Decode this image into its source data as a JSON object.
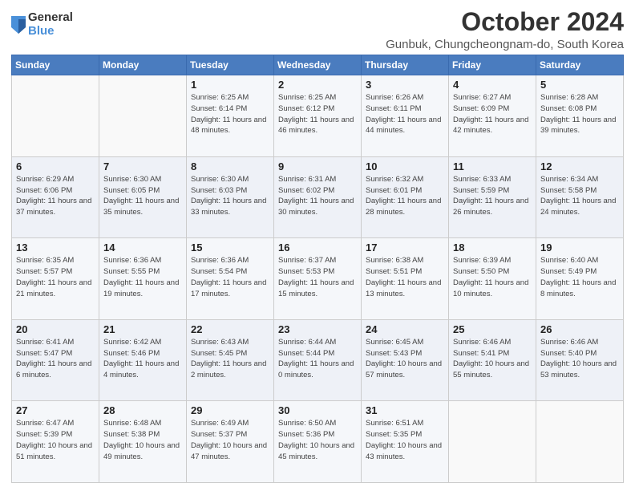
{
  "logo": {
    "general": "General",
    "blue": "Blue"
  },
  "header": {
    "title": "October 2024",
    "subtitle": "Gunbuk, Chungcheongnam-do, South Korea"
  },
  "columns": [
    "Sunday",
    "Monday",
    "Tuesday",
    "Wednesday",
    "Thursday",
    "Friday",
    "Saturday"
  ],
  "weeks": [
    [
      {
        "day": "",
        "info": ""
      },
      {
        "day": "",
        "info": ""
      },
      {
        "day": "1",
        "info": "Sunrise: 6:25 AM\nSunset: 6:14 PM\nDaylight: 11 hours and 48 minutes."
      },
      {
        "day": "2",
        "info": "Sunrise: 6:25 AM\nSunset: 6:12 PM\nDaylight: 11 hours and 46 minutes."
      },
      {
        "day": "3",
        "info": "Sunrise: 6:26 AM\nSunset: 6:11 PM\nDaylight: 11 hours and 44 minutes."
      },
      {
        "day": "4",
        "info": "Sunrise: 6:27 AM\nSunset: 6:09 PM\nDaylight: 11 hours and 42 minutes."
      },
      {
        "day": "5",
        "info": "Sunrise: 6:28 AM\nSunset: 6:08 PM\nDaylight: 11 hours and 39 minutes."
      }
    ],
    [
      {
        "day": "6",
        "info": "Sunrise: 6:29 AM\nSunset: 6:06 PM\nDaylight: 11 hours and 37 minutes."
      },
      {
        "day": "7",
        "info": "Sunrise: 6:30 AM\nSunset: 6:05 PM\nDaylight: 11 hours and 35 minutes."
      },
      {
        "day": "8",
        "info": "Sunrise: 6:30 AM\nSunset: 6:03 PM\nDaylight: 11 hours and 33 minutes."
      },
      {
        "day": "9",
        "info": "Sunrise: 6:31 AM\nSunset: 6:02 PM\nDaylight: 11 hours and 30 minutes."
      },
      {
        "day": "10",
        "info": "Sunrise: 6:32 AM\nSunset: 6:01 PM\nDaylight: 11 hours and 28 minutes."
      },
      {
        "day": "11",
        "info": "Sunrise: 6:33 AM\nSunset: 5:59 PM\nDaylight: 11 hours and 26 minutes."
      },
      {
        "day": "12",
        "info": "Sunrise: 6:34 AM\nSunset: 5:58 PM\nDaylight: 11 hours and 24 minutes."
      }
    ],
    [
      {
        "day": "13",
        "info": "Sunrise: 6:35 AM\nSunset: 5:57 PM\nDaylight: 11 hours and 21 minutes."
      },
      {
        "day": "14",
        "info": "Sunrise: 6:36 AM\nSunset: 5:55 PM\nDaylight: 11 hours and 19 minutes."
      },
      {
        "day": "15",
        "info": "Sunrise: 6:36 AM\nSunset: 5:54 PM\nDaylight: 11 hours and 17 minutes."
      },
      {
        "day": "16",
        "info": "Sunrise: 6:37 AM\nSunset: 5:53 PM\nDaylight: 11 hours and 15 minutes."
      },
      {
        "day": "17",
        "info": "Sunrise: 6:38 AM\nSunset: 5:51 PM\nDaylight: 11 hours and 13 minutes."
      },
      {
        "day": "18",
        "info": "Sunrise: 6:39 AM\nSunset: 5:50 PM\nDaylight: 11 hours and 10 minutes."
      },
      {
        "day": "19",
        "info": "Sunrise: 6:40 AM\nSunset: 5:49 PM\nDaylight: 11 hours and 8 minutes."
      }
    ],
    [
      {
        "day": "20",
        "info": "Sunrise: 6:41 AM\nSunset: 5:47 PM\nDaylight: 11 hours and 6 minutes."
      },
      {
        "day": "21",
        "info": "Sunrise: 6:42 AM\nSunset: 5:46 PM\nDaylight: 11 hours and 4 minutes."
      },
      {
        "day": "22",
        "info": "Sunrise: 6:43 AM\nSunset: 5:45 PM\nDaylight: 11 hours and 2 minutes."
      },
      {
        "day": "23",
        "info": "Sunrise: 6:44 AM\nSunset: 5:44 PM\nDaylight: 11 hours and 0 minutes."
      },
      {
        "day": "24",
        "info": "Sunrise: 6:45 AM\nSunset: 5:43 PM\nDaylight: 10 hours and 57 minutes."
      },
      {
        "day": "25",
        "info": "Sunrise: 6:46 AM\nSunset: 5:41 PM\nDaylight: 10 hours and 55 minutes."
      },
      {
        "day": "26",
        "info": "Sunrise: 6:46 AM\nSunset: 5:40 PM\nDaylight: 10 hours and 53 minutes."
      }
    ],
    [
      {
        "day": "27",
        "info": "Sunrise: 6:47 AM\nSunset: 5:39 PM\nDaylight: 10 hours and 51 minutes."
      },
      {
        "day": "28",
        "info": "Sunrise: 6:48 AM\nSunset: 5:38 PM\nDaylight: 10 hours and 49 minutes."
      },
      {
        "day": "29",
        "info": "Sunrise: 6:49 AM\nSunset: 5:37 PM\nDaylight: 10 hours and 47 minutes."
      },
      {
        "day": "30",
        "info": "Sunrise: 6:50 AM\nSunset: 5:36 PM\nDaylight: 10 hours and 45 minutes."
      },
      {
        "day": "31",
        "info": "Sunrise: 6:51 AM\nSunset: 5:35 PM\nDaylight: 10 hours and 43 minutes."
      },
      {
        "day": "",
        "info": ""
      },
      {
        "day": "",
        "info": ""
      }
    ]
  ]
}
